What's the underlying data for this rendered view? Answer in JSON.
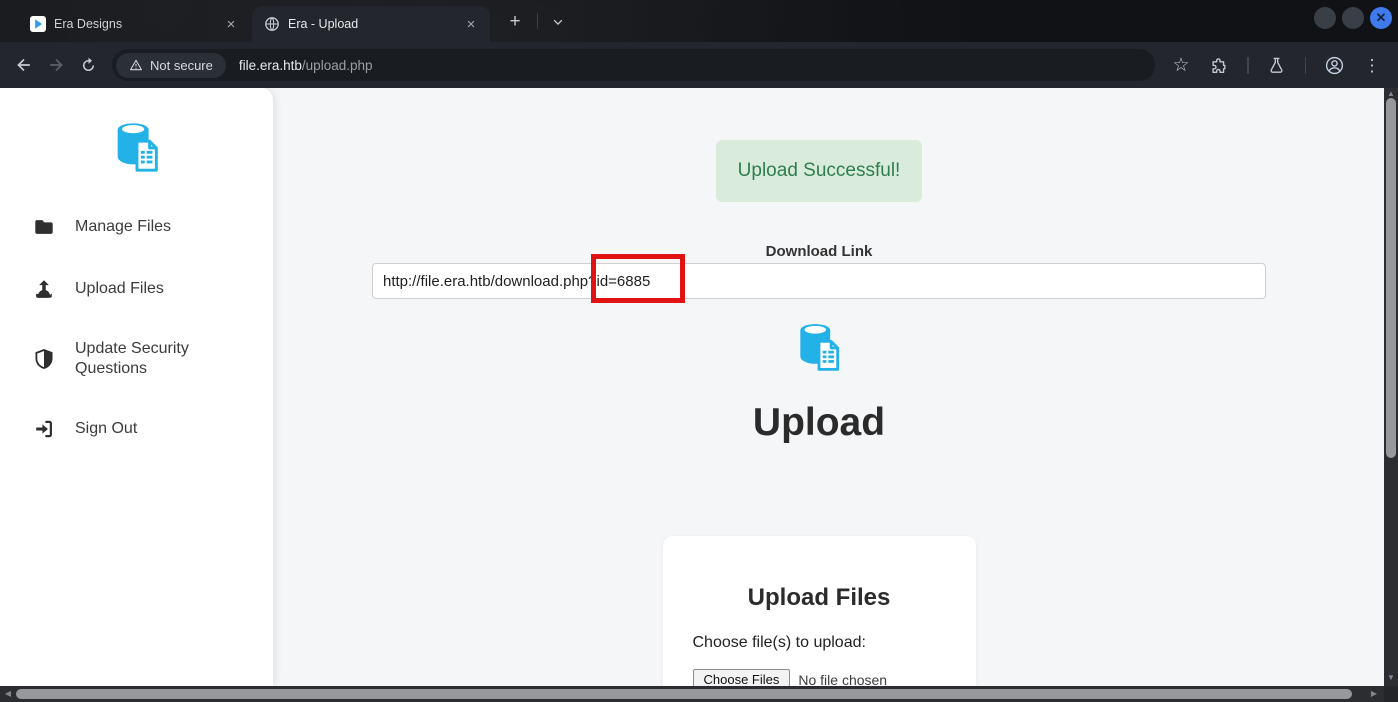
{
  "glyphs": {
    "close_tab": "×",
    "new_tab": "+",
    "close_window": "✕",
    "star": "☆",
    "menu_dots": "⋮",
    "scroll_up": "▲",
    "scroll_down": "▼",
    "scroll_left": "◀",
    "scroll_right": "▶"
  },
  "browser": {
    "tabs": [
      {
        "title": "Era Designs",
        "active": false
      },
      {
        "title": "Era - Upload",
        "active": true
      }
    ],
    "address": {
      "security_label": "Not secure",
      "host": "file.era.htb",
      "path": "/upload.php"
    }
  },
  "sidebar": {
    "items": [
      {
        "label": "Manage Files"
      },
      {
        "label": "Upload Files"
      },
      {
        "label": "Update Security Questions"
      },
      {
        "label": "Sign Out"
      }
    ]
  },
  "page": {
    "banner_text": "Upload Successful!",
    "download_label": "Download Link",
    "download_url": "http://file.era.htb/download.php?id=6885",
    "heading": "Upload",
    "card_title": "Upload Files",
    "card_prompt": "Choose file(s) to upload:",
    "file_button": "Choose Files",
    "file_status": "No file chosen"
  },
  "annotation": {
    "highlighted_text": "?id=6885",
    "color": "#e01212"
  },
  "colors": {
    "accent_cyan": "#23b2e8",
    "banner_bg": "#d9ecdc",
    "banner_text": "#2f7d4c",
    "close_button_blue": "#3f7bed",
    "page_bg": "#f5f6f8"
  }
}
